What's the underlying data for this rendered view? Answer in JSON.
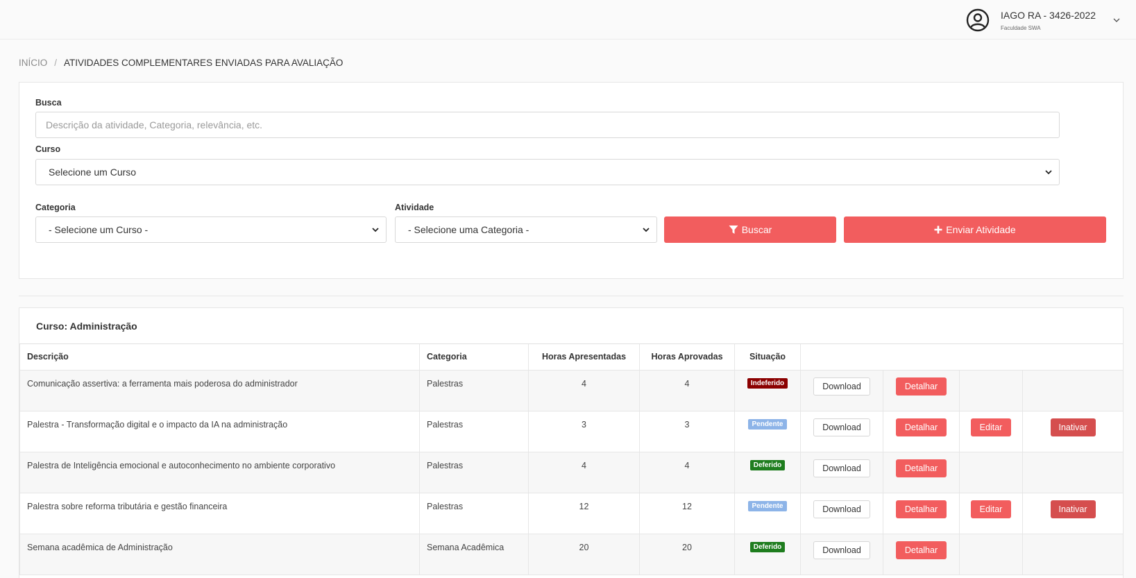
{
  "user": {
    "name": "IAGO RA - 3426-2022",
    "institution": "Faculdade SWA"
  },
  "breadcrumb": {
    "home": "INÍCIO",
    "separator": "/",
    "current": "ATIVIDADES COMPLEMENTARES ENVIADAS PARA AVALIAÇÃO"
  },
  "filters": {
    "search_label": "Busca",
    "search_placeholder": "Descrição da atividade, Categoria, relevância, etc.",
    "course_label": "Curso",
    "course_value": "Selecione um Curso",
    "category_label": "Categoria",
    "category_value": "- Selecione um Curso -",
    "activity_label": "Atividade",
    "activity_value": "- Selecione uma Categoria -",
    "search_button": "Buscar",
    "send_button": "Enviar Atividade"
  },
  "table": {
    "title": "Curso: Administração",
    "columns": [
      "Descrição",
      "Categoria",
      "Horas Apresentadas",
      "Horas Aprovadas",
      "Situação"
    ],
    "download_label": "Download",
    "detail_label": "Detalhar",
    "edit_label": "Editar",
    "deactivate_label": "Inativar",
    "rows": [
      {
        "description": "Comunicação assertiva: a ferramenta mais poderosa do administrador",
        "category": "Palestras",
        "hours_presented": "4",
        "hours_approved": "4",
        "status": "Indeferido",
        "editable": false
      },
      {
        "description": "Palestra - Transformação digital e o impacto da IA na administração",
        "category": "Palestras",
        "hours_presented": "3",
        "hours_approved": "3",
        "status": "Pendente",
        "editable": true
      },
      {
        "description": "Palestra de Inteligência emocional e autoconhecimento no ambiente corporativo",
        "category": "Palestras",
        "hours_presented": "4",
        "hours_approved": "4",
        "status": "Deferido",
        "editable": false
      },
      {
        "description": "Palestra sobre reforma tributária e gestão financeira",
        "category": "Palestras",
        "hours_presented": "12",
        "hours_approved": "12",
        "status": "Pendente",
        "editable": true
      },
      {
        "description": "Semana acadêmica de Administração",
        "category": "Semana Acadêmica",
        "hours_presented": "20",
        "hours_approved": "20",
        "status": "Deferido",
        "editable": false
      }
    ]
  },
  "colors": {
    "accent": "#f25d5e",
    "danger_dark": "#d54e4e",
    "status_indeferido": "#8b0000",
    "status_pendente": "#8db4e8",
    "status_deferido": "#1e7d1e"
  }
}
